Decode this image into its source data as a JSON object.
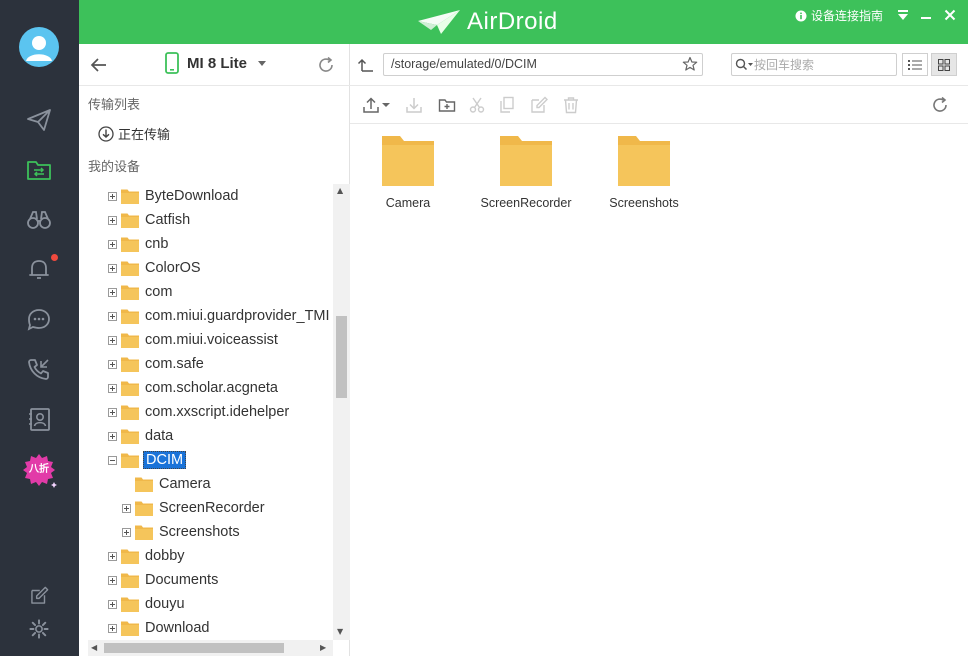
{
  "header": {
    "logo_text": "AirDroid",
    "guide_label": "设备连接指南",
    "accent": "#3dc15a"
  },
  "rail": {
    "promo_label": "八折",
    "icons": [
      "avatar-icon",
      "send-icon",
      "file-transfer-icon",
      "binoculars-icon",
      "bell-icon",
      "message-icon",
      "phone-icon",
      "contacts-icon",
      "promo-badge",
      "edit-icon",
      "settings-icon"
    ]
  },
  "sidebar": {
    "device_name": "MI 8 Lite",
    "transfer_list_label": "传输列表",
    "transferring_label": "正在传输",
    "my_devices_label": "我的设备",
    "tree": [
      {
        "label": "ByteDownload",
        "level": 0,
        "expander": "plus"
      },
      {
        "label": "Catfish",
        "level": 0,
        "expander": "plus"
      },
      {
        "label": "cnb",
        "level": 0,
        "expander": "plus"
      },
      {
        "label": "ColorOS",
        "level": 0,
        "expander": "plus"
      },
      {
        "label": "com",
        "level": 0,
        "expander": "plus"
      },
      {
        "label": "com.miui.guardprovider_TMI",
        "level": 0,
        "expander": "plus"
      },
      {
        "label": "com.miui.voiceassist",
        "level": 0,
        "expander": "plus"
      },
      {
        "label": "com.safe",
        "level": 0,
        "expander": "plus"
      },
      {
        "label": "com.scholar.acgneta",
        "level": 0,
        "expander": "plus"
      },
      {
        "label": "com.xxscript.idehelper",
        "level": 0,
        "expander": "plus"
      },
      {
        "label": "data",
        "level": 0,
        "expander": "plus"
      },
      {
        "label": "DCIM",
        "level": 0,
        "expander": "minus",
        "selected": true
      },
      {
        "label": "Camera",
        "level": 1,
        "expander": "none"
      },
      {
        "label": "ScreenRecorder",
        "level": 1,
        "expander": "plus"
      },
      {
        "label": "Screenshots",
        "level": 1,
        "expander": "plus"
      },
      {
        "label": "dobby",
        "level": 0,
        "expander": "plus"
      },
      {
        "label": "Documents",
        "level": 0,
        "expander": "plus"
      },
      {
        "label": "douyu",
        "level": 0,
        "expander": "plus"
      },
      {
        "label": "Download",
        "level": 0,
        "expander": "plus"
      }
    ]
  },
  "main": {
    "path": "/storage/emulated/0/DCIM",
    "search_placeholder": "按回车搜索",
    "folders": [
      "Camera",
      "ScreenRecorder",
      "Screenshots"
    ],
    "folder_color": "#f5c55b"
  }
}
